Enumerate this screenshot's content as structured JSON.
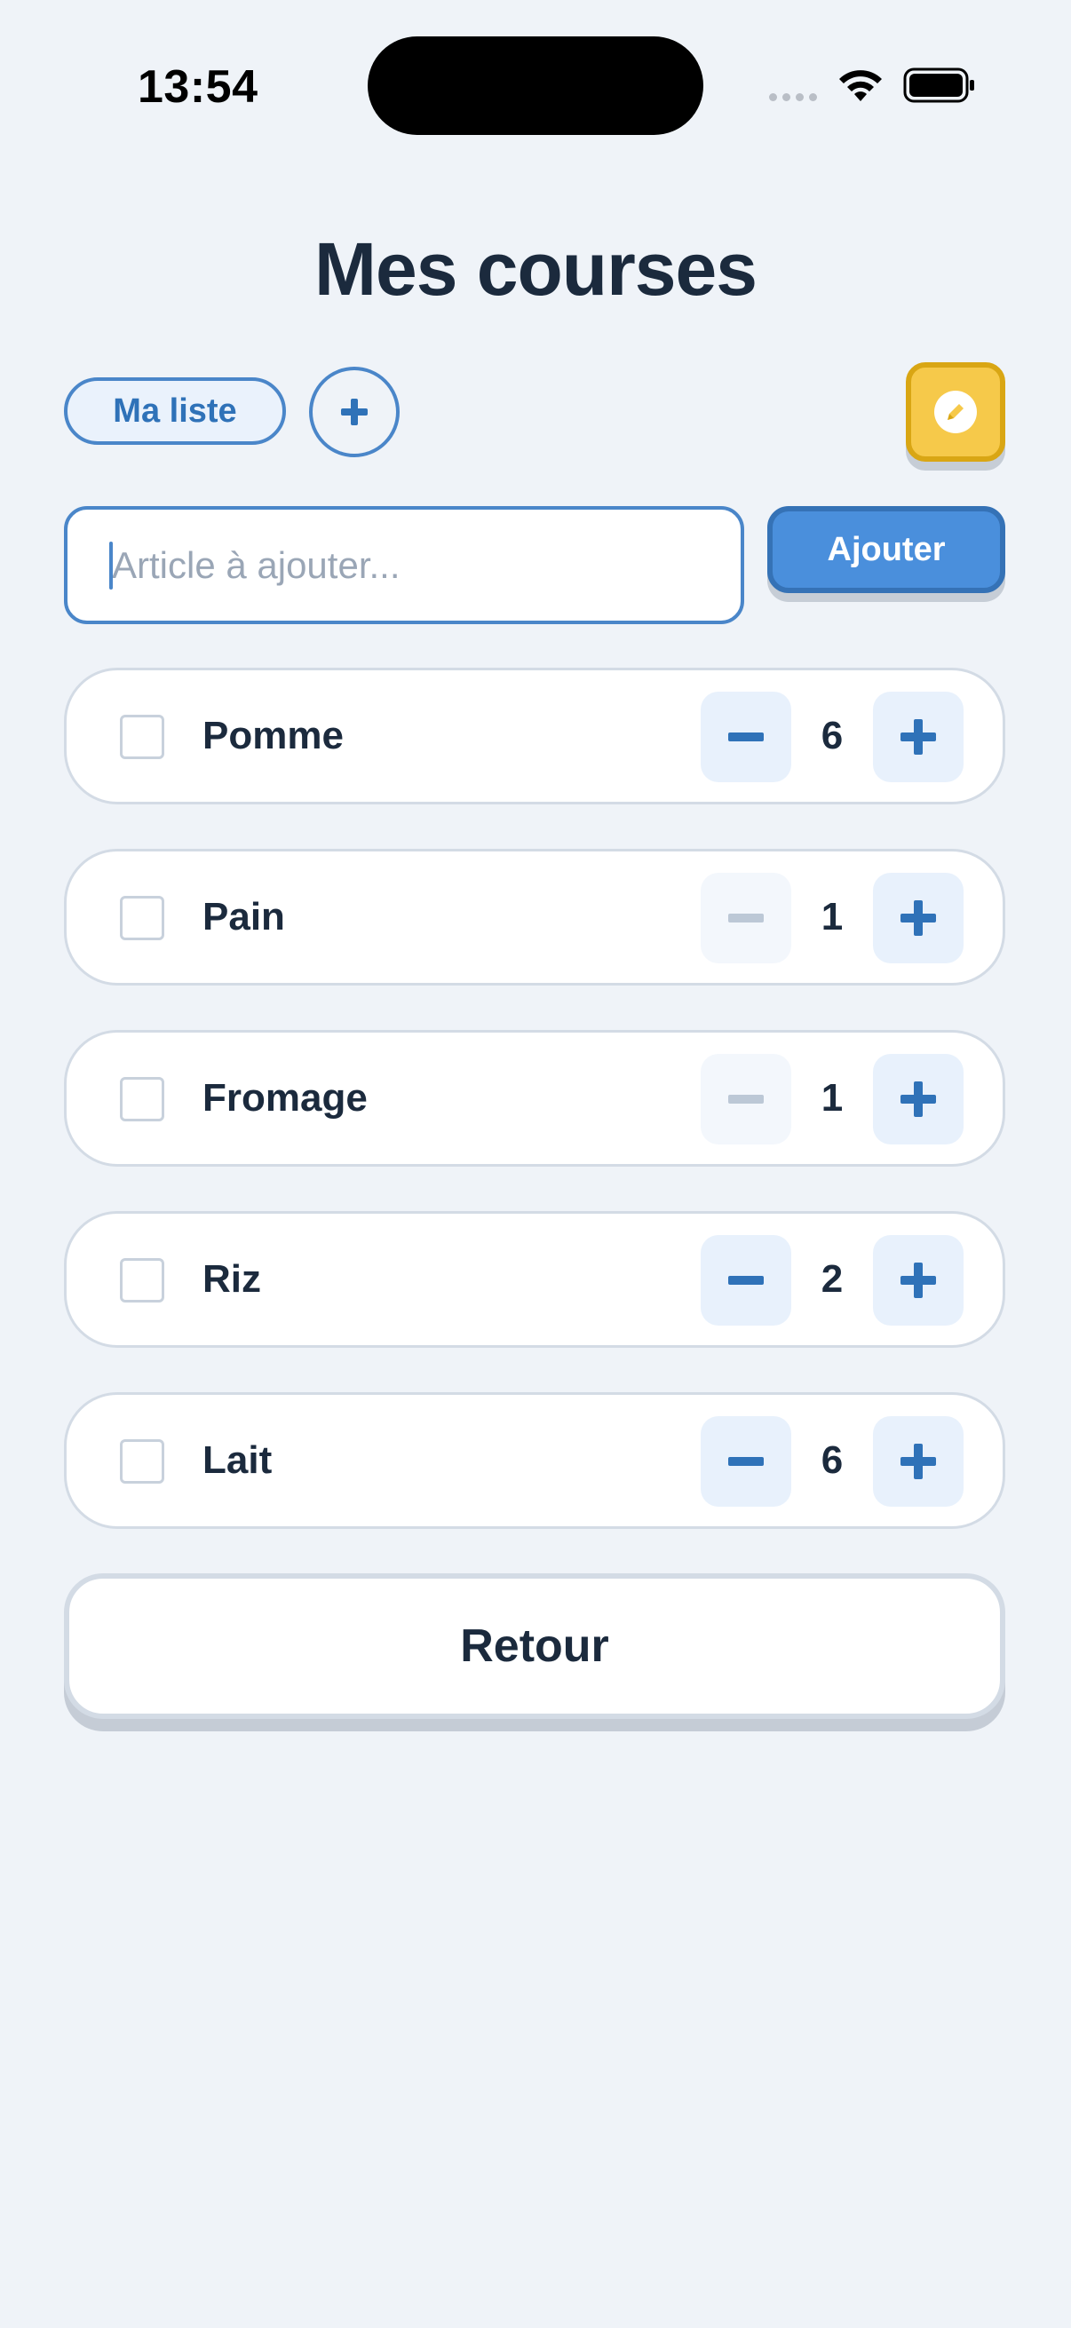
{
  "status_bar": {
    "time": "13:54"
  },
  "header": {
    "title": "Mes courses"
  },
  "lists": {
    "current_list_label": "Ma liste",
    "add_list_icon": "plus-icon",
    "edit_icon": "pencil-icon"
  },
  "add_form": {
    "input_value": "",
    "input_placeholder": "Article à ajouter...",
    "add_button_label": "Ajouter"
  },
  "items": [
    {
      "name": "Pomme",
      "quantity": "6",
      "checked": false,
      "minus_enabled": true
    },
    {
      "name": "Pain",
      "quantity": "1",
      "checked": false,
      "minus_enabled": false
    },
    {
      "name": "Fromage",
      "quantity": "1",
      "checked": false,
      "minus_enabled": false
    },
    {
      "name": "Riz",
      "quantity": "2",
      "checked": false,
      "minus_enabled": true
    },
    {
      "name": "Lait",
      "quantity": "6",
      "checked": false,
      "minus_enabled": true
    }
  ],
  "footer": {
    "back_button_label": "Retour"
  },
  "colors": {
    "background": "#eff3f8",
    "accent_blue": "#4a8fdc",
    "accent_yellow": "#f6c94a",
    "text_dark": "#1b2a3d"
  }
}
